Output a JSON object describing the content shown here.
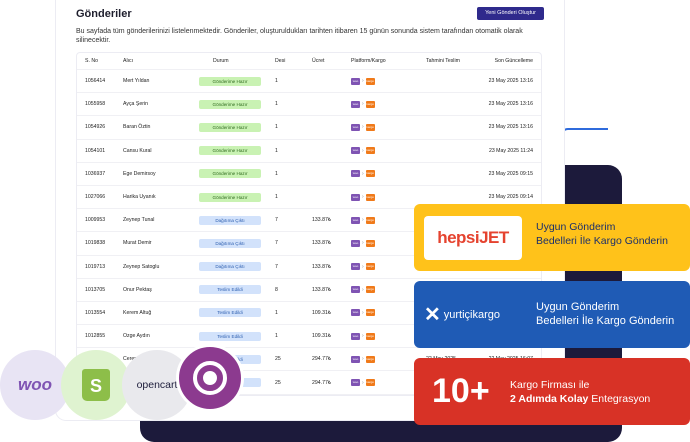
{
  "page": {
    "title": "Gönderiler",
    "new_button": "Yeni Gönderi Oluştur",
    "description": "Bu sayfada tüm gönderilerinizi listelenmektedir. Gönderiler, oluşturuldukları tarihten itibaren 15 günün sonunda sistem tarafından otomatik olarak silinecektir."
  },
  "table": {
    "columns": [
      "S. No",
      "Alıcı",
      "Durum",
      "Desi",
      "Ücret",
      "Platform/Kargo",
      "Tahmini Teslim",
      "Son Güncelleme"
    ],
    "rows": [
      {
        "no": "1056414",
        "alici": "Mert Yıldan",
        "durum": "Gönderime Hazır",
        "status": "green",
        "desi": "1",
        "ucret": "",
        "tahmini": "",
        "son": "23 May 2025 13:16"
      },
      {
        "no": "1055958",
        "alici": "Ayça Şerin",
        "durum": "Gönderime Hazır",
        "status": "green",
        "desi": "1",
        "ucret": "",
        "tahmini": "",
        "son": "23 May 2025 13:16"
      },
      {
        "no": "1054926",
        "alici": "Baran Öztin",
        "durum": "Gönderime Hazır",
        "status": "green",
        "desi": "1",
        "ucret": "",
        "tahmini": "",
        "son": "23 May 2025 13:16"
      },
      {
        "no": "1054101",
        "alici": "Cansu Kural",
        "durum": "Gönderime Hazır",
        "status": "green",
        "desi": "1",
        "ucret": "",
        "tahmini": "",
        "son": "23 May 2025 11:24"
      },
      {
        "no": "1036937",
        "alici": "Ege Demirsoy",
        "durum": "Gönderime Hazır",
        "status": "green",
        "desi": "1",
        "ucret": "",
        "tahmini": "",
        "son": "23 May 2025 09:15"
      },
      {
        "no": "1027066",
        "alici": "Harika Uyanık",
        "durum": "Gönderime Hazır",
        "status": "green",
        "desi": "1",
        "ucret": "",
        "tahmini": "",
        "son": "23 May 2025 09:14"
      },
      {
        "no": "1009953",
        "alici": "Zeynep Tunal",
        "durum": "Dağıtıma Çıktı",
        "status": "blue",
        "desi": "7",
        "ucret": "133.87₺",
        "tahmini": "",
        "son": ""
      },
      {
        "no": "1019838",
        "alici": "Murat Demir",
        "durum": "Dağıtıma Çıktı",
        "status": "blue",
        "desi": "7",
        "ucret": "133.87₺",
        "tahmini": "",
        "son": ""
      },
      {
        "no": "1019713",
        "alici": "Zeynep Satoglu",
        "durum": "Dağıtıma Çıktı",
        "status": "blue",
        "desi": "7",
        "ucret": "133.87₺",
        "tahmini": "",
        "son": ""
      },
      {
        "no": "1013705",
        "alici": "Onur Pektaş",
        "durum": "Teslim Edildi",
        "status": "blue",
        "desi": "8",
        "ucret": "133.87₺",
        "tahmini": "",
        "son": ""
      },
      {
        "no": "1013554",
        "alici": "Kerem Altuğ",
        "durum": "Teslim Edildi",
        "status": "blue",
        "desi": "1",
        "ucret": "109.31₺",
        "tahmini": "",
        "son": ""
      },
      {
        "no": "1012855",
        "alici": "Ozge Aydın",
        "durum": "Teslim Edildi",
        "status": "blue",
        "desi": "1",
        "ucret": "109.31₺",
        "tahmini": "",
        "son": ""
      },
      {
        "no": "",
        "alici": "Ceren",
        "durum": "Teslim Edildi",
        "status": "blue",
        "desi": "25",
        "ucret": "294.77₺",
        "tahmini": "22 May 2025",
        "son": "22 May 2025 16:07"
      },
      {
        "no": "",
        "alici": "",
        "durum": "Teslim Edildi",
        "status": "blue",
        "desi": "25",
        "ucret": "294.77₺",
        "tahmini": "",
        "son": "23 May 2025 11:38"
      }
    ],
    "platform_label": "woo",
    "kargo_label": "kargo"
  },
  "promos": {
    "hepsijet": {
      "logo": "hepsiJET",
      "line1": "Uygun Gönderim",
      "line2": "Bedelleri İle Kargo Gönderin"
    },
    "yurtici": {
      "logo": "yurtiçikargo",
      "line1": "Uygun Gönderim",
      "line2": "Bedelleri İle Kargo Gönderin"
    },
    "carriers": {
      "big": "10+",
      "line1": "Kargo Firması ile",
      "line2_bold": "2 Adımda Kolay",
      "line2_rest": " Entegrasyon"
    }
  },
  "integrations": {
    "woo": "woo",
    "shopify": "S",
    "opencart": "opencart"
  },
  "colors": {
    "navy": "#1c1a3b",
    "button": "#2f2a8c",
    "hepsi_card": "#ffc21a",
    "yurtici_card": "#1f5bb5",
    "carriers_card": "#d83226"
  }
}
